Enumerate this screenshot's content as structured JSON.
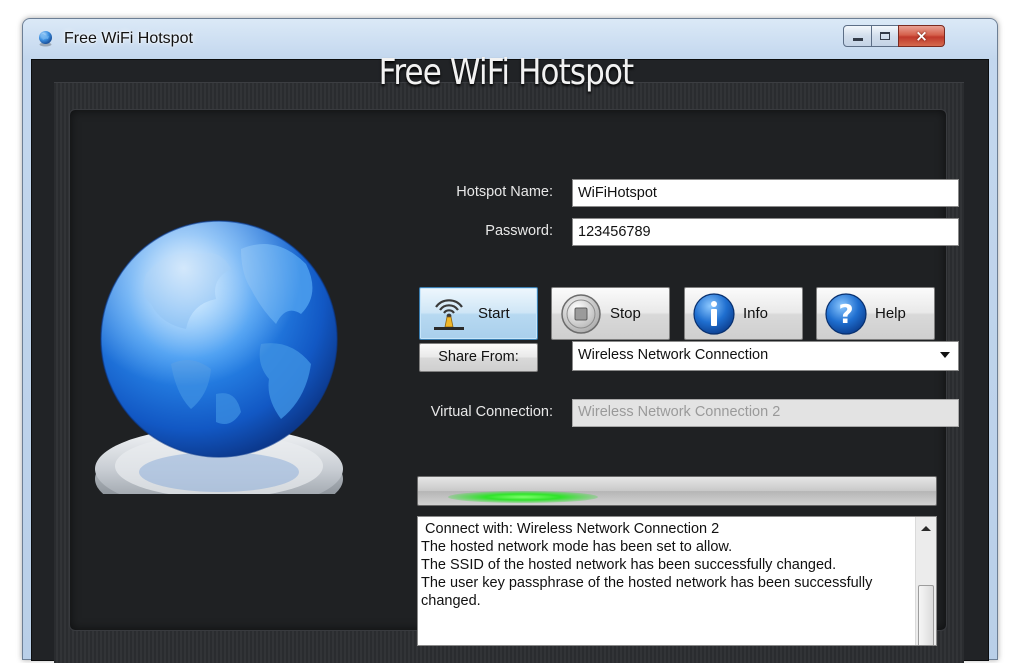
{
  "window": {
    "title": "Free WiFi Hotspot",
    "icon": "globe-icon",
    "controls": {
      "minimize": "minimize-icon",
      "maximize": "maximize-icon",
      "close": "×"
    }
  },
  "app": {
    "heading": "Free WiFi Hotspot"
  },
  "form": {
    "hotspot_name_label": "Hotspot Name:",
    "hotspot_name_value": "WiFiHotspot",
    "password_label": "Password:",
    "password_value": "123456789",
    "share_from_button": "Share From:",
    "share_from_selected": "Wireless Network Connection",
    "virtual_connection_label": "Virtual Connection:",
    "virtual_connection_value": "Wireless Network Connection 2"
  },
  "buttons": [
    {
      "label": "Start",
      "icon": "wifi-antenna-icon",
      "active": true
    },
    {
      "label": "Stop",
      "icon": "stop-icon",
      "active": false
    },
    {
      "label": "Info",
      "icon": "info-icon",
      "active": false
    },
    {
      "label": "Help",
      "icon": "help-icon",
      "active": false
    }
  ],
  "progress": {
    "state": "running (animated glow)"
  },
  "log": {
    "lines": [
      " Connect with: Wireless Network Connection 2",
      "The hosted network mode has been set to allow.",
      "The SSID of the hosted network has been successfully changed.",
      "The user key passphrase of the hosted network has been successfully changed."
    ]
  },
  "colors": {
    "accent_blue": "#1f6fd0",
    "background_dark": "#212326",
    "progress_green": "#2fe32a"
  }
}
